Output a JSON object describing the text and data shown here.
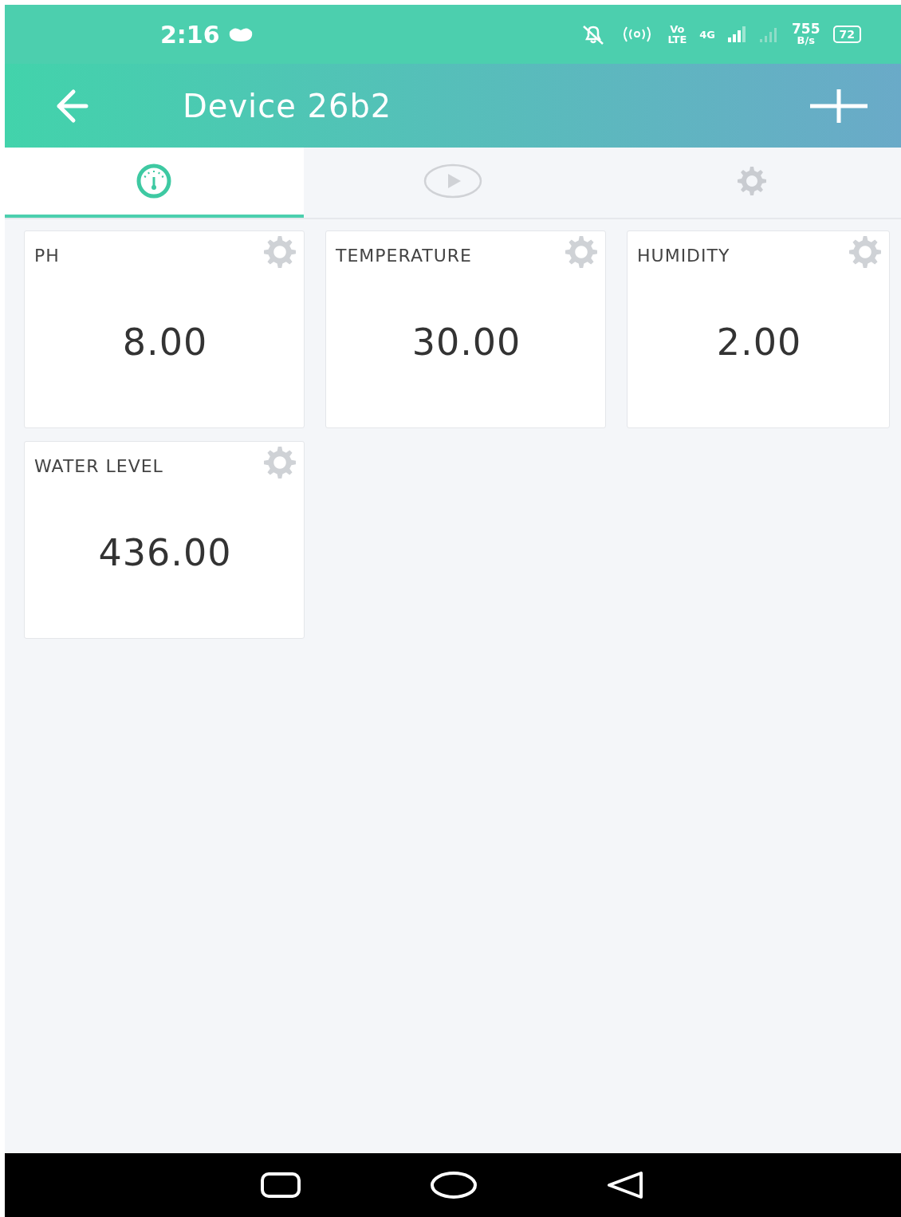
{
  "status_bar": {
    "time": "2:16",
    "volte_top": "Vo",
    "volte_bottom": "LTE",
    "network_type": "4G",
    "data_rate": "755",
    "data_unit": "B/s",
    "battery": "72"
  },
  "header": {
    "title": "Device 26b2"
  },
  "tabs": [
    {
      "kind": "gauge",
      "selected": true
    },
    {
      "kind": "play",
      "selected": false
    },
    {
      "kind": "settings",
      "selected": false
    }
  ],
  "widgets": [
    {
      "label": "PH",
      "value": "8.00"
    },
    {
      "label": "TEMPERATURE",
      "value": "30.00"
    },
    {
      "label": "HUMIDITY",
      "value": "2.00"
    },
    {
      "label": "WATER LEVEL",
      "value": "436.00"
    }
  ]
}
